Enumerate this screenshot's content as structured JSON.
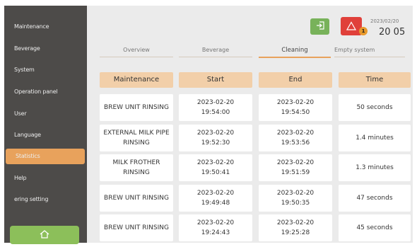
{
  "sidebar": {
    "items": [
      {
        "label": "Maintenance"
      },
      {
        "label": "Beverage"
      },
      {
        "label": "System"
      },
      {
        "label": "Operation panel"
      },
      {
        "label": "User"
      },
      {
        "label": "Language"
      },
      {
        "label": "Statistics"
      },
      {
        "label": "Help"
      },
      {
        "label": "ering setting"
      }
    ],
    "active": "Statistics",
    "home_icon": "home-icon"
  },
  "header": {
    "exit_icon": "exit-icon",
    "alarm_icon": "warning-icon",
    "alarm_count": "1",
    "date": "2023/02/20",
    "time": "20 05"
  },
  "tabs": [
    {
      "label": "Overview"
    },
    {
      "label": "Beverage"
    },
    {
      "label": "Cleaning"
    },
    {
      "label": "Empty system"
    }
  ],
  "active_tab": "Cleaning",
  "table": {
    "headers": [
      "Maintenance",
      "Start",
      "End",
      "Time"
    ],
    "rows": [
      {
        "name": "BREW UNIT RINSING",
        "start_date": "2023-02-20",
        "start_time": "19:54:00",
        "end_date": "2023-02-20",
        "end_time": "19:54:50",
        "duration": "50 seconds"
      },
      {
        "name": "EXTERNAL MILK PIPE RINSING",
        "start_date": "2023-02-20",
        "start_time": "19:52:30",
        "end_date": "2023-02-20",
        "end_time": "19:53:56",
        "duration": "1.4 minutes"
      },
      {
        "name": "MILK FROTHER RINSING",
        "start_date": "2023-02-20",
        "start_time": "19:50:41",
        "end_date": "2023-02-20",
        "end_time": "19:51:59",
        "duration": "1.3 minutes"
      },
      {
        "name": "BREW UNIT RINSING",
        "start_date": "2023-02-20",
        "start_time": "19:49:48",
        "end_date": "2023-02-20",
        "end_time": "19:50:35",
        "duration": "47 seconds"
      },
      {
        "name": "BREW UNIT RINSING",
        "start_date": "2023-02-20",
        "start_time": "19:24:43",
        "end_date": "2023-02-20",
        "end_time": "19:25:28",
        "duration": "45 seconds"
      }
    ]
  },
  "colors": {
    "sidebar_bg": "#4d4b49",
    "accent": "#e8a25c",
    "header_cell": "#f2cfa9",
    "exit_button": "#78b25a",
    "alarm_button": "#e0403a",
    "home_button": "#8cbf5a"
  }
}
